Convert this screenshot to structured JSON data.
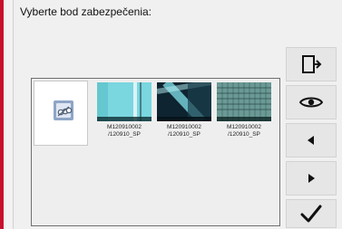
{
  "header": {
    "title": "Vyberte bod zabezpečenia:"
  },
  "items": [
    {
      "name": "selected-item",
      "caption": ""
    },
    {
      "name": "item-1",
      "caption": "M120910002\n/120910_SP"
    },
    {
      "name": "item-2",
      "caption": "M120910002\n/120910_SP"
    },
    {
      "name": "item-3",
      "caption": "M120910002\n/120910_SP"
    }
  ],
  "toolbar": {
    "exit_icon": "exit-icon",
    "view_icon": "eye-icon",
    "prev_icon": "left-arrow-icon",
    "next_icon": "right-arrow-icon",
    "confirm_icon": "checkmark-icon"
  },
  "colors": {
    "accent": "#c8102e"
  }
}
